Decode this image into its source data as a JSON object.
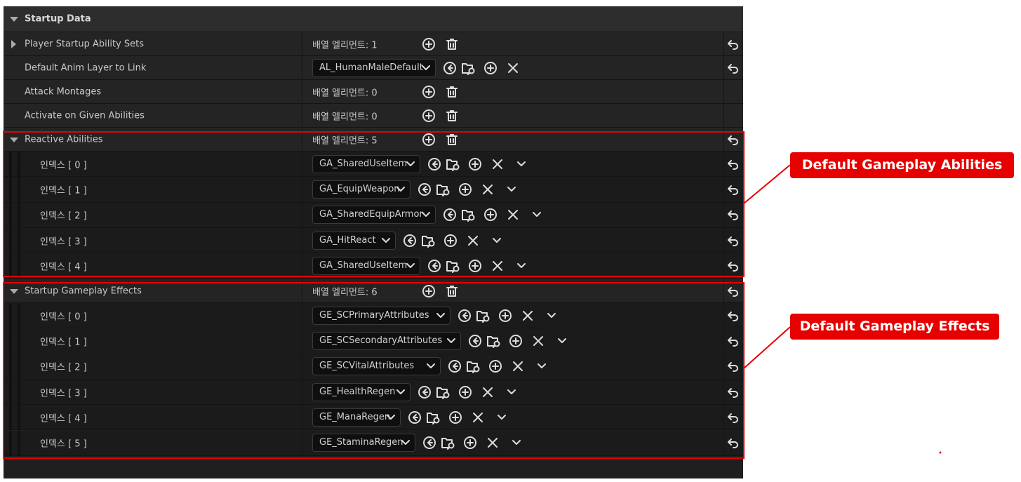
{
  "section": {
    "title": "Startup Data"
  },
  "properties": [
    {
      "label": "Player Startup Ability Sets",
      "count": "배열 엘리먼트: 1"
    },
    {
      "label": "Default Anim Layer to Link",
      "asset": "AL_HumanMaleDefault"
    },
    {
      "label": "Attack Montages",
      "count": "배열 엘리먼트: 0"
    },
    {
      "label": "Activate on Given Abilities",
      "count": "배열 엘리먼트: 0"
    },
    {
      "label": "Reactive Abilities",
      "count": "배열 엘리먼트: 5"
    },
    {
      "label": "Startup Gameplay Effects",
      "count": "배열 엘리먼트: 6"
    }
  ],
  "reactive_abilities": [
    {
      "index": "인덱스 [ 0 ]",
      "asset": "GA_SharedUseItem"
    },
    {
      "index": "인덱스 [ 1 ]",
      "asset": "GA_EquipWeapon"
    },
    {
      "index": "인덱스 [ 2 ]",
      "asset": "GA_SharedEquipArmor"
    },
    {
      "index": "인덱스 [ 3 ]",
      "asset": "GA_HitReact"
    },
    {
      "index": "인덱스 [ 4 ]",
      "asset": "GA_SharedUseItem"
    }
  ],
  "startup_effects": [
    {
      "index": "인덱스 [ 0 ]",
      "asset": "GE_SCPrimaryAttributes"
    },
    {
      "index": "인덱스 [ 1 ]",
      "asset": "GE_SCSecondaryAttributes"
    },
    {
      "index": "인덱스 [ 2 ]",
      "asset": "GE_SCVitalAttributes"
    },
    {
      "index": "인덱스 [ 3 ]",
      "asset": "GE_HealthRegen"
    },
    {
      "index": "인덱스 [ 4 ]",
      "asset": "GE_ManaRegen"
    },
    {
      "index": "인덱스 [ 5 ]",
      "asset": "GE_StaminaRegen"
    }
  ],
  "annotations": {
    "abilities": "Default Gameplay Abilities",
    "effects": "Default Gameplay Effects"
  },
  "colors": {
    "annotation": "#e60000",
    "panel": "#1f1f1f"
  },
  "icons": [
    "expand-triangle-icon",
    "add-element-icon",
    "delete-all-icon",
    "use-selected-asset-icon",
    "browse-asset-icon",
    "clear-icon",
    "element-menu-chevron-icon",
    "reset-to-default-icon",
    "dropdown-chevron-icon"
  ]
}
